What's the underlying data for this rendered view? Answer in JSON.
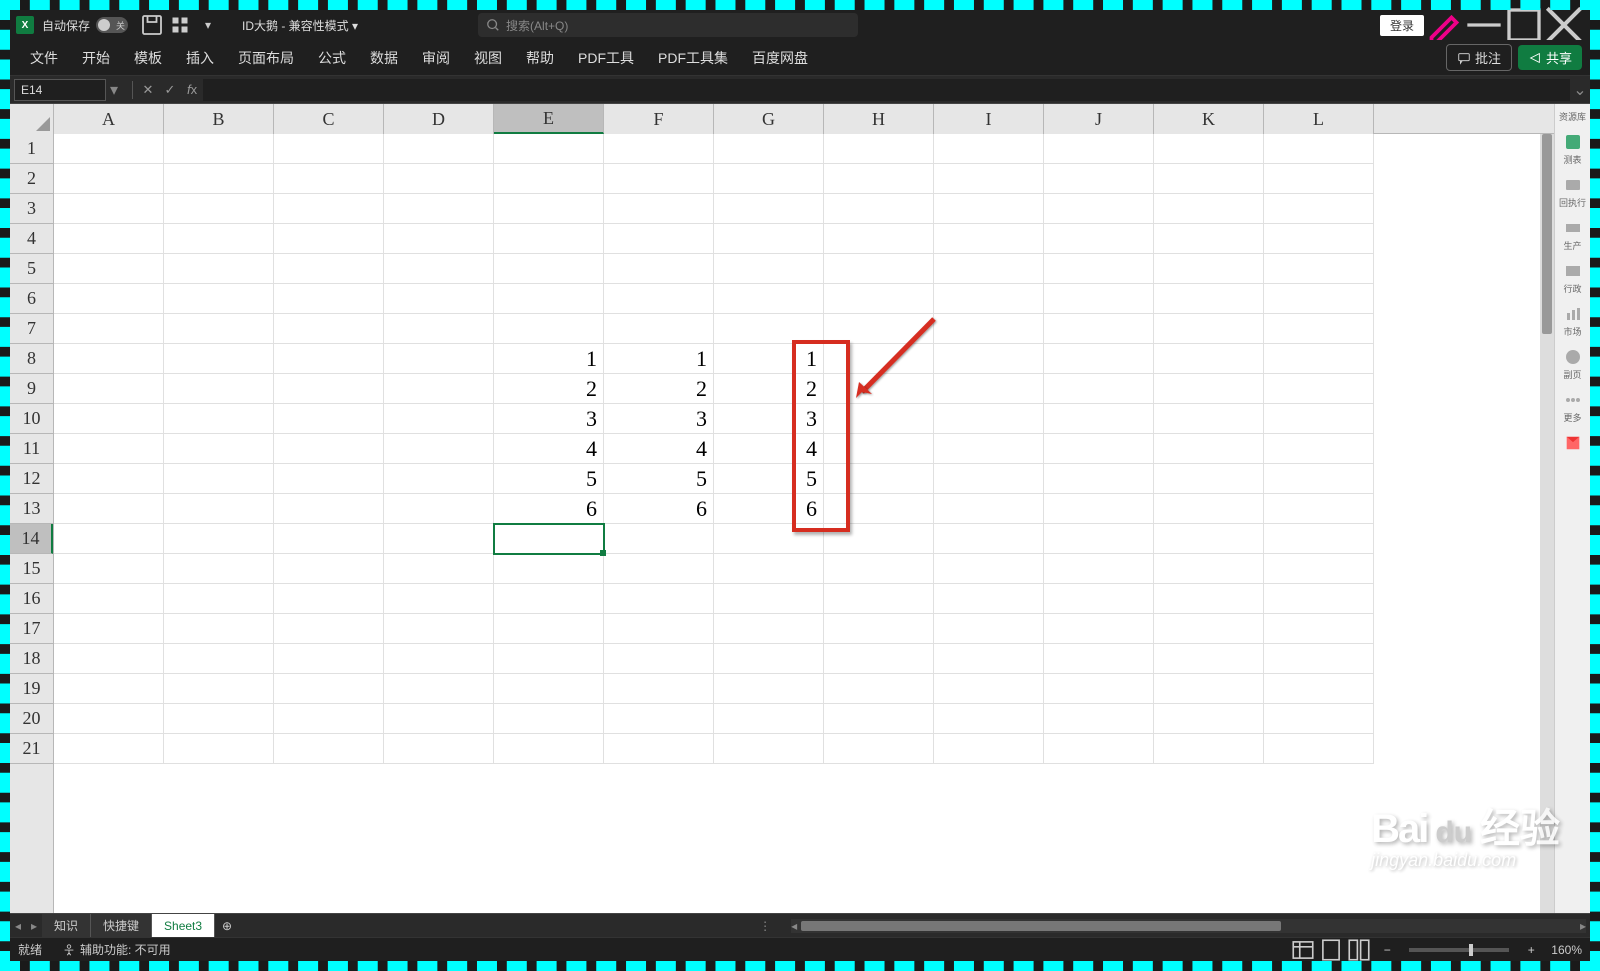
{
  "titlebar": {
    "autosave_label": "自动保存",
    "autosave_state": "关",
    "doc_title": "ID大鹅  - 兼容性模式 ▾",
    "search_placeholder": "搜索(Alt+Q)",
    "login_label": "登录"
  },
  "ribbon": {
    "tabs": [
      "文件",
      "开始",
      "模板",
      "插入",
      "页面布局",
      "公式",
      "数据",
      "审阅",
      "视图",
      "帮助",
      "PDF工具",
      "PDF工具集",
      "百度网盘"
    ],
    "comment_label": "批注",
    "share_label": "共享"
  },
  "formula_bar": {
    "name_box": "E14",
    "formula_value": ""
  },
  "columns": [
    "A",
    "B",
    "C",
    "D",
    "E",
    "F",
    "G",
    "H",
    "I",
    "J",
    "K",
    "L"
  ],
  "rows_visible": 21,
  "active_cell": {
    "col": "E",
    "row": 14
  },
  "cell_data": {
    "E8": "1",
    "E9": "2",
    "E10": "3",
    "E11": "4",
    "E12": "5",
    "E13": "6",
    "F8": "1",
    "F9": "2",
    "F10": "3",
    "F11": "4",
    "F12": "5",
    "F13": "6",
    "G8": "1",
    "G9": "2",
    "G10": "3",
    "G11": "4",
    "G12": "5",
    "G13": "6"
  },
  "side_panel": {
    "library_label": "资源库",
    "items": [
      "测表",
      "回执行",
      "生产",
      "行政",
      "市场",
      "副页",
      "更多"
    ]
  },
  "sheet_tabs": {
    "tabs": [
      "知识",
      "快捷键",
      "Sheet3"
    ],
    "active_index": 2
  },
  "status_bar": {
    "ready": "就绪",
    "accessibility": "辅助功能: 不可用",
    "zoom_label": "160%"
  },
  "watermark": {
    "brand": "Baidu",
    "suffix": "经验",
    "url": "jingyan.baidu.com"
  }
}
